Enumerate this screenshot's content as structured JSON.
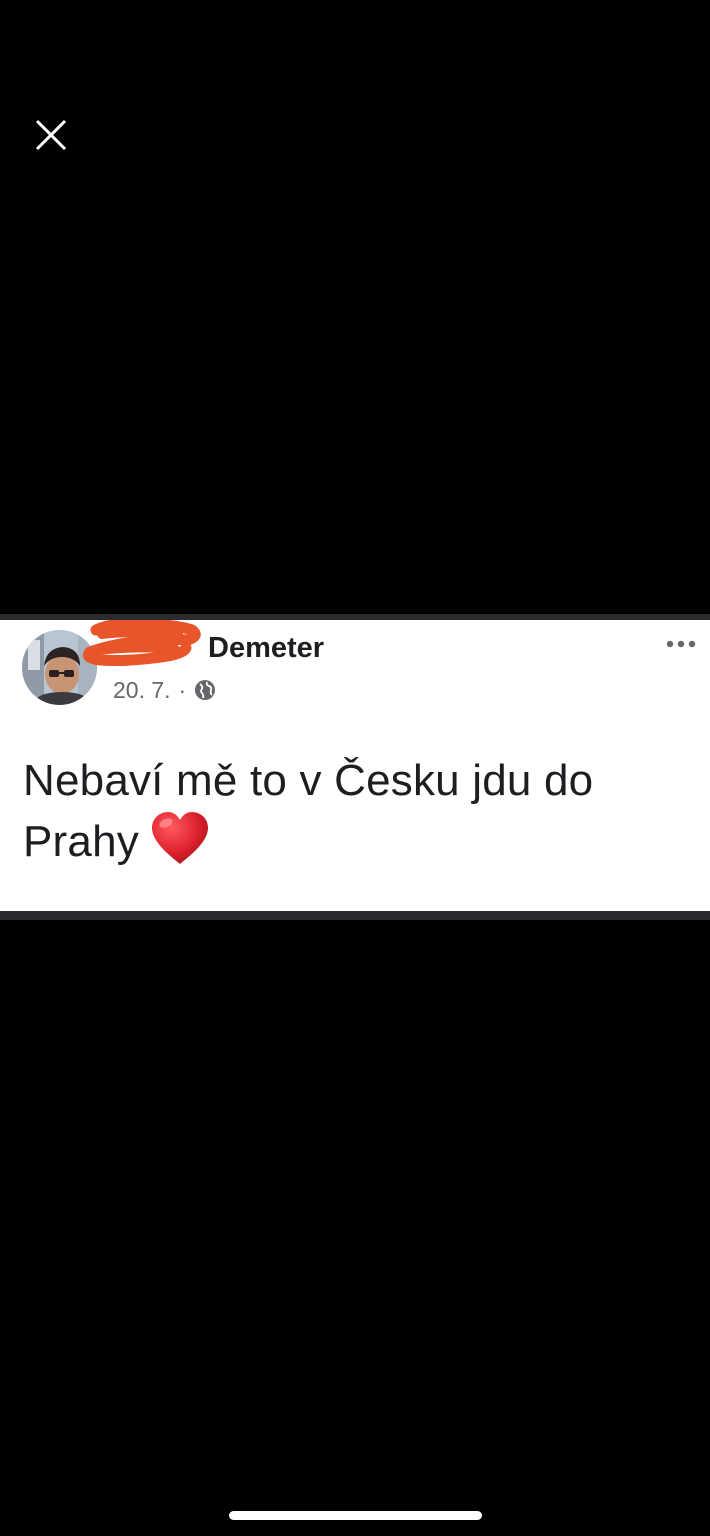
{
  "viewer": {
    "close_icon": "close-icon"
  },
  "post": {
    "author_name": "Demeter",
    "date": "20. 7.",
    "separator": "·",
    "privacy_icon": "globe-icon",
    "more_icon": "more-horizontal-icon",
    "text": "Nebaví mě to v Česku jdu do Prahy",
    "emoji": "heart-emoji",
    "redaction_color": "#e8552b"
  },
  "colors": {
    "background": "#000000",
    "card": "#ffffff",
    "text": "#1c1e21",
    "meta": "#65676b",
    "heart": "#e0242f"
  }
}
